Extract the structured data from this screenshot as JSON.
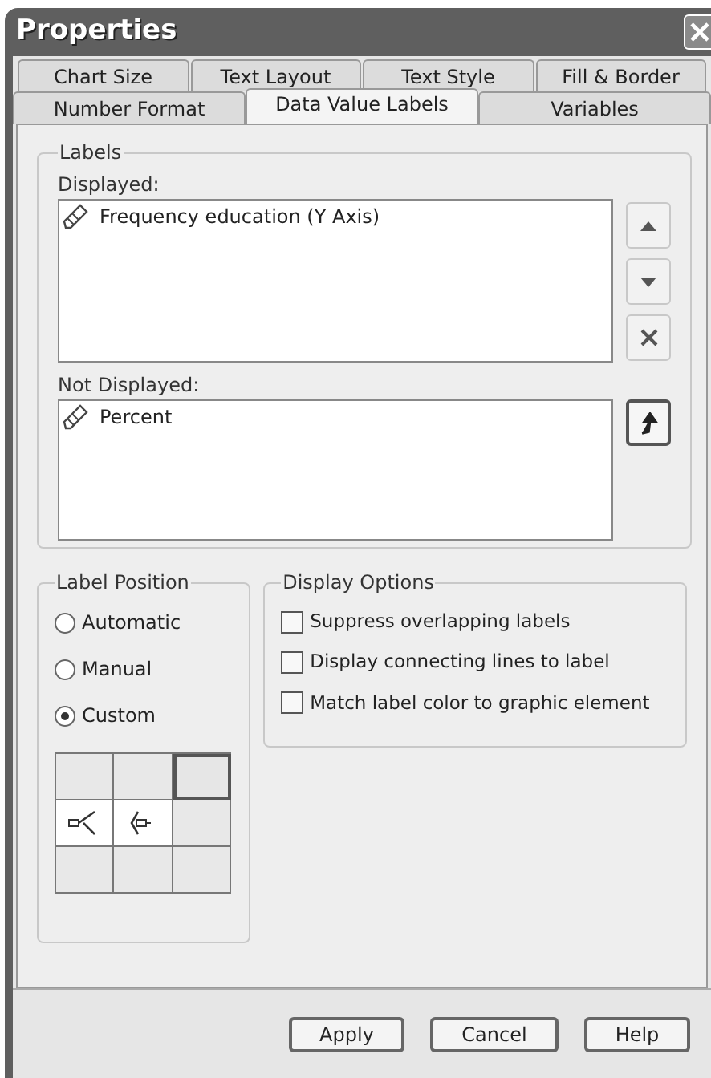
{
  "window": {
    "title": "Properties"
  },
  "tab_rows": [
    [
      {
        "label": "Chart Size",
        "selected": false
      },
      {
        "label": "Text Layout",
        "selected": false
      },
      {
        "label": "Text Style",
        "selected": false
      },
      {
        "label": "Fill & Border",
        "selected": false
      }
    ],
    [
      {
        "label": "Number Format",
        "selected": false
      },
      {
        "label": "Data Value Labels",
        "selected": true
      },
      {
        "label": "Variables",
        "selected": false
      }
    ]
  ],
  "labels": {
    "title": "Labels",
    "displayed_label": "Displayed:",
    "displayed": [
      "Frequency education (Y Axis)"
    ],
    "not_displayed_label": "Not Displayed:",
    "not_displayed": [
      "Percent"
    ]
  },
  "label_position": {
    "title": "Label Position",
    "options": [
      {
        "label": "Automatic",
        "selected": false
      },
      {
        "label": "Manual",
        "selected": false
      },
      {
        "label": "Custom",
        "selected": true
      }
    ],
    "grid": [
      {
        "kind": "empty",
        "selected": false
      },
      {
        "kind": "empty",
        "selected": false
      },
      {
        "kind": "empty",
        "selected": true
      },
      {
        "kind": "marker_left",
        "selected": false
      },
      {
        "kind": "marker_center",
        "selected": false
      },
      {
        "kind": "empty",
        "selected": false
      },
      {
        "kind": "empty",
        "selected": false
      },
      {
        "kind": "empty",
        "selected": false
      },
      {
        "kind": "empty",
        "selected": false
      }
    ]
  },
  "display_options": {
    "title": "Display Options",
    "items": [
      {
        "label": "Suppress overlapping labels",
        "checked": false
      },
      {
        "label": "Display connecting lines to label",
        "checked": false
      },
      {
        "label": "Match label color to graphic element",
        "checked": false
      }
    ]
  },
  "buttons": [
    "Apply",
    "Cancel",
    "Help"
  ]
}
